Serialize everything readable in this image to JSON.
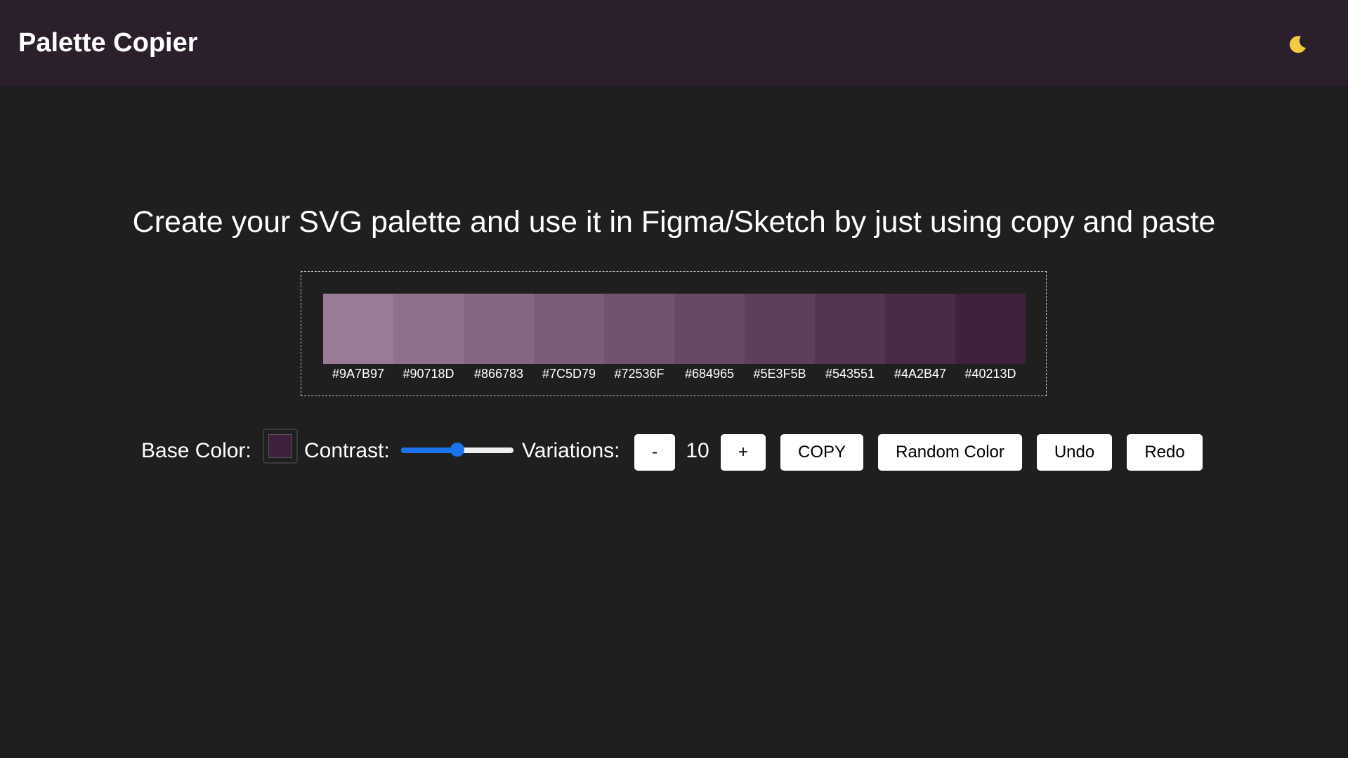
{
  "header": {
    "title": "Palette Copier",
    "theme_icon": "crescent-moon-icon",
    "theme_icon_color": "#f6c945"
  },
  "main": {
    "headline": "Create your SVG palette and use it in Figma/Sketch by just using copy and paste"
  },
  "palette": {
    "swatches": [
      {
        "hex": "#9A7B97",
        "label": "#9A7B97"
      },
      {
        "hex": "#90718D",
        "label": "#90718D"
      },
      {
        "hex": "#866783",
        "label": "#866783"
      },
      {
        "hex": "#7C5D79",
        "label": "#7C5D79"
      },
      {
        "hex": "#72536F",
        "label": "#72536F"
      },
      {
        "hex": "#684965",
        "label": "#684965"
      },
      {
        "hex": "#5E3F5B",
        "label": "#5E3F5B"
      },
      {
        "hex": "#543551",
        "label": "#543551"
      },
      {
        "hex": "#4A2B47",
        "label": "#4A2B47"
      },
      {
        "hex": "#40213D",
        "label": "#40213D"
      }
    ]
  },
  "controls": {
    "base_color_label": "Base Color:",
    "base_color_value": "#40213D",
    "contrast_label": "Contrast:",
    "contrast_value": 0.5,
    "variations_label": "Variations:",
    "decrement_label": "-",
    "variations_count": "10",
    "increment_label": "+",
    "copy_label": "COPY",
    "random_label": "Random Color",
    "undo_label": "Undo",
    "redo_label": "Redo"
  },
  "colors": {
    "header_bg": "#2c1f2c",
    "page_bg": "#1f1f1f",
    "accent": "#1a73e8"
  }
}
